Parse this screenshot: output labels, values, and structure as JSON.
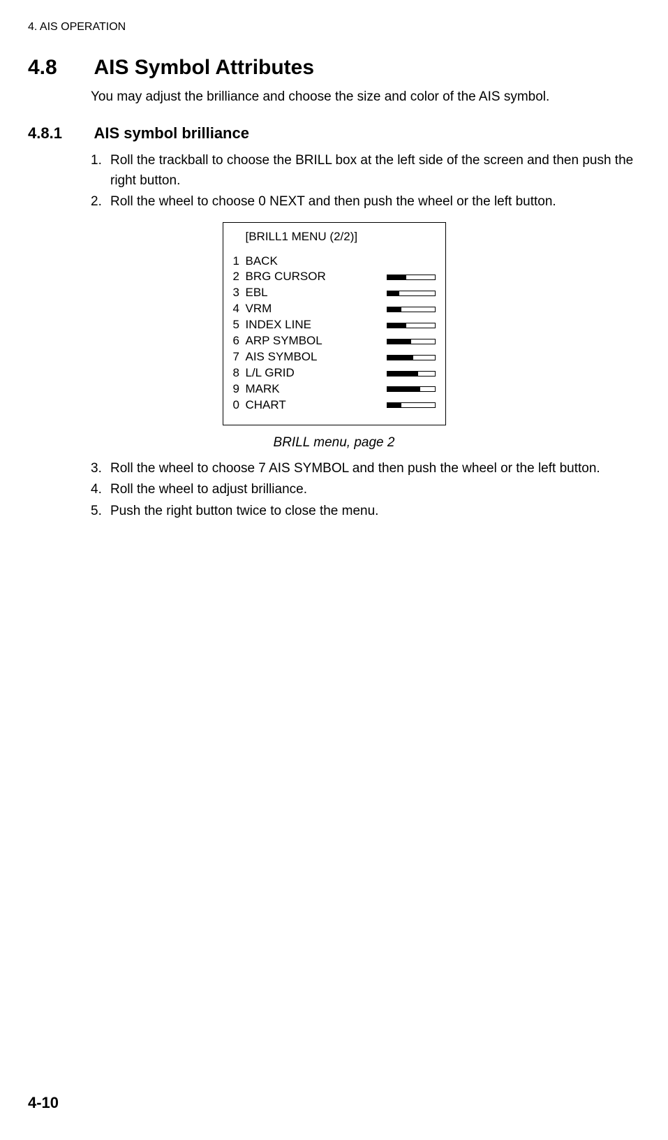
{
  "header": "4. AIS OPERATION",
  "section": {
    "number": "4.8",
    "title": "AIS Symbol Attributes",
    "intro": "You may adjust the brilliance and choose the size and color of the AIS symbol."
  },
  "subsection": {
    "number": "4.8.1",
    "title": "AIS symbol brilliance"
  },
  "steps_before": [
    {
      "num": "1.",
      "text": "Roll the trackball to choose the BRILL box at the left side of the screen and then push the right button."
    },
    {
      "num": "2.",
      "text": "Roll the wheel to choose 0 NEXT and then push the wheel or the left button."
    }
  ],
  "menu": {
    "title": "[BRILL1 MENU (2/2)]",
    "items": [
      {
        "num": "1",
        "label": "BACK",
        "slider": false,
        "fill": 0
      },
      {
        "num": "2",
        "label": "BRG CURSOR",
        "slider": true,
        "fill": 40
      },
      {
        "num": "3",
        "label": "EBL",
        "slider": true,
        "fill": 25
      },
      {
        "num": "4",
        "label": "VRM",
        "slider": true,
        "fill": 30
      },
      {
        "num": "5",
        "label": "INDEX LINE",
        "slider": true,
        "fill": 40
      },
      {
        "num": "6",
        "label": "ARP SYMBOL",
        "slider": true,
        "fill": 50
      },
      {
        "num": "7",
        "label": "AIS SYMBOL",
        "slider": true,
        "fill": 55
      },
      {
        "num": "8",
        "label": "L/L GRID",
        "slider": true,
        "fill": 65
      },
      {
        "num": "9",
        "label": "MARK",
        "slider": true,
        "fill": 70
      },
      {
        "num": "0",
        "label": "CHART",
        "slider": true,
        "fill": 30
      }
    ]
  },
  "figure_caption": "BRILL menu, page 2",
  "steps_after": [
    {
      "num": "3.",
      "text": "Roll the wheel to choose 7 AIS SYMBOL and then push the wheel or the left button."
    },
    {
      "num": "4.",
      "text": "Roll the wheel to adjust brilliance."
    },
    {
      "num": "5.",
      "text": "Push the right button twice to close the menu."
    }
  ],
  "page_number": "4-10"
}
